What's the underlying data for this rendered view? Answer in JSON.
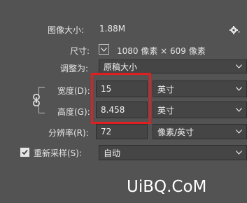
{
  "image_size": {
    "label": "图像大小:",
    "value": "1.88M"
  },
  "dimensions": {
    "label": "尺寸:",
    "value": "1080 像素 × 609 像素"
  },
  "fit_to": {
    "label": "调整为:",
    "value": "原稿大小"
  },
  "width": {
    "label": "宽度(D):",
    "value": "15",
    "unit": "英寸"
  },
  "height": {
    "label": "高度(G):",
    "value": "8.458",
    "unit": "英寸"
  },
  "resolution": {
    "label": "分辨率(R):",
    "value": "72",
    "unit": "像素/英寸"
  },
  "resample": {
    "label": "重新采样(S):",
    "value": "自动",
    "checked": true
  },
  "watermark": {
    "text": "UiBQ.CoM"
  },
  "colors": {
    "panel": "#535353",
    "field": "#454545",
    "highlight": "#e02020",
    "text": "#e6e6e6"
  },
  "icons": [
    "gear-icon",
    "chevron-down-icon",
    "link-icon",
    "checkmark-icon"
  ]
}
